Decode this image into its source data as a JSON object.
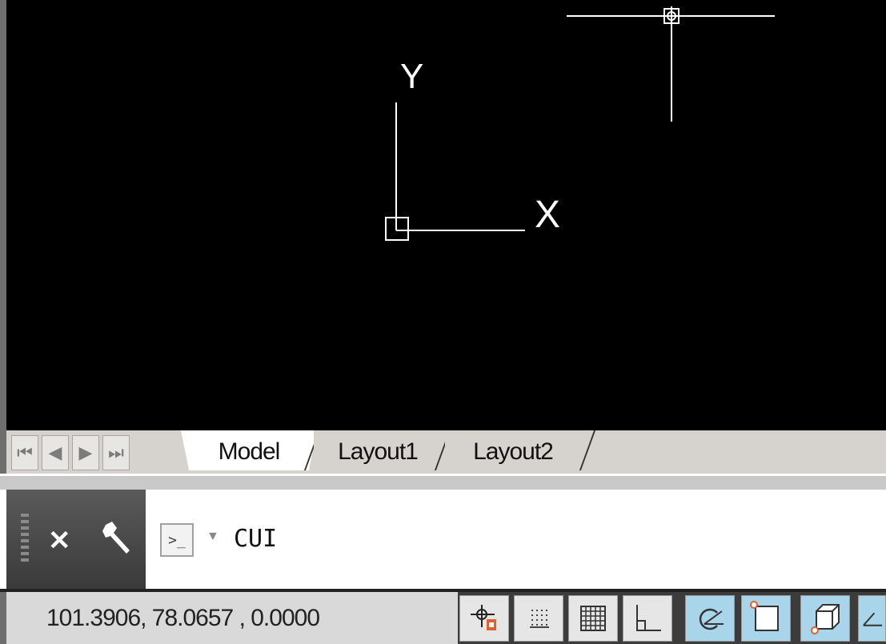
{
  "drawing": {
    "ucs_x_label": "X",
    "ucs_y_label": "Y"
  },
  "layout_tabs": [
    {
      "label": "Model",
      "active": true
    },
    {
      "label": "Layout1",
      "active": false
    },
    {
      "label": "Layout2",
      "active": false
    }
  ],
  "command_line": {
    "text": "CUI",
    "icons": [
      "grip-handle",
      "close-icon",
      "wrench-icon",
      "command-prompt-icon",
      "dropdown-caret-icon"
    ]
  },
  "status_bar": {
    "coordinates": "101.3906, 78.0657 , 0.0000",
    "toggles": [
      {
        "name": "infer-constraints",
        "on": false
      },
      {
        "name": "snap-mode",
        "on": false
      },
      {
        "name": "grid-display",
        "on": false
      },
      {
        "name": "ortho-mode",
        "on": false
      },
      {
        "name": "polar-tracking",
        "on": true
      },
      {
        "name": "object-snap",
        "on": true
      },
      {
        "name": "3d-object-snap",
        "on": true
      },
      {
        "name": "object-snap-tracking",
        "on": true
      }
    ]
  },
  "colors": {
    "canvas": "#000000",
    "active_toggle": "#a9d5ea"
  }
}
